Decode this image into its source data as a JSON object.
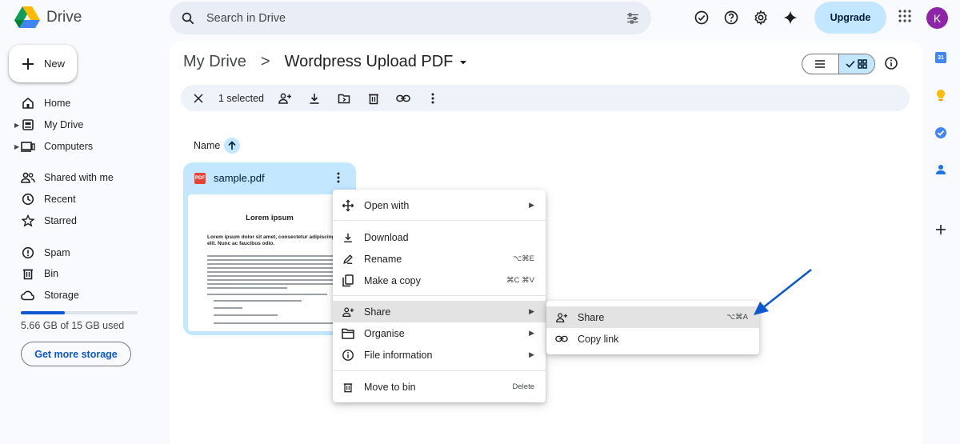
{
  "app": {
    "name": "Drive"
  },
  "search": {
    "placeholder": "Search in Drive"
  },
  "header": {
    "upgrade_label": "Upgrade",
    "avatar_initial": "K"
  },
  "sidebar": {
    "new_label": "New",
    "items": [
      {
        "label": "Home"
      },
      {
        "label": "My Drive"
      },
      {
        "label": "Computers"
      },
      {
        "label": "Shared with me"
      },
      {
        "label": "Recent"
      },
      {
        "label": "Starred"
      },
      {
        "label": "Spam"
      },
      {
        "label": "Bin"
      },
      {
        "label": "Storage"
      }
    ],
    "storage_used_fraction": 0.38,
    "storage_text": "5.66 GB of 15 GB used",
    "get_more_storage_label": "Get more storage"
  },
  "breadcrumb": {
    "root": "My Drive",
    "separator": ">",
    "current": "Wordpress Upload PDF"
  },
  "selection_bar": {
    "count_label": "1 selected"
  },
  "list_header": {
    "name_label": "Name"
  },
  "file": {
    "name": "sample.pdf",
    "badge": "PDF",
    "preview_title": "Lorem ipsum",
    "preview_heading": "Lorem ipsum dolor sit amet, consectetur adipiscing elit. Nunc ac faucibus odio."
  },
  "context_menu": {
    "open_with": {
      "label": "Open with"
    },
    "download": {
      "label": "Download"
    },
    "rename": {
      "label": "Rename",
      "shortcut": "⌥⌘E"
    },
    "make_copy": {
      "label": "Make a copy",
      "shortcut": "⌘C ⌘V"
    },
    "share": {
      "label": "Share"
    },
    "organise": {
      "label": "Organise"
    },
    "file_info": {
      "label": "File information"
    },
    "move_to_bin": {
      "label": "Move to bin",
      "shortcut": "Delete"
    }
  },
  "share_submenu": {
    "share": {
      "label": "Share",
      "shortcut": "⌥⌘A"
    },
    "copy_link": {
      "label": "Copy link"
    }
  },
  "right_rail": {
    "calendar_day": "31"
  },
  "colors": {
    "accent": "#0b57d0",
    "selected_bg": "#c2e7ff",
    "annotation_arrow": "#0b57d0"
  }
}
